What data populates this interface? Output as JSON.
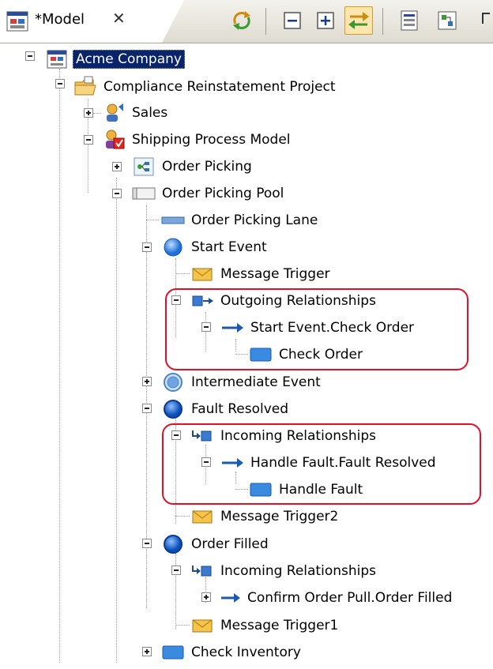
{
  "tab": {
    "title": "*Model",
    "close_glyph": "✕"
  },
  "toolbar": {
    "buttons": [
      "sync-icon",
      "collapse-all-icon",
      "expand-all-icon",
      "link-with-editor-icon",
      "filter-icon",
      "layout-icon"
    ]
  },
  "tree": {
    "root": "Acme Company",
    "project": "Compliance Reinstatement  Project",
    "sales": "Sales",
    "shipping": "Shipping Process Model",
    "order_picking": "Order Picking",
    "order_picking_pool": "Order Picking Pool",
    "order_picking_lane": "Order Picking Lane",
    "start_event": "Start Event",
    "message_trigger": "Message Trigger",
    "outgoing_relationships": "Outgoing Relationships",
    "start_event_check_order": "Start Event.Check Order",
    "check_order": "Check Order",
    "intermediate_event": "Intermediate Event",
    "fault_resolved": "Fault Resolved",
    "incoming_relationships": "Incoming Relationships",
    "handle_fault_fault_resolved": "Handle Fault.Fault Resolved",
    "handle_fault": "Handle Fault",
    "message_trigger2": "Message Trigger2",
    "order_filled": "Order Filled",
    "incoming_relationships_2": "Incoming Relationships",
    "confirm_order_pull": "Confirm Order Pull.Order Filled",
    "message_trigger1": "Message Trigger1",
    "check_inventory": "Check Inventory"
  },
  "colors": {
    "selection": "#0a246a",
    "highlight_border": "#e0102a"
  }
}
